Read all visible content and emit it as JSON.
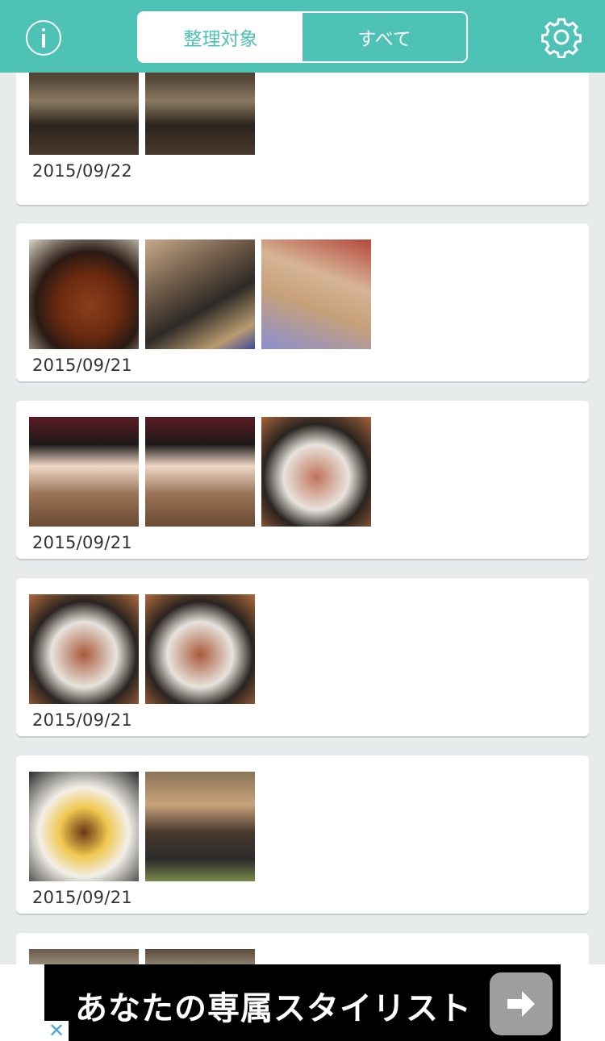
{
  "header": {
    "info_icon": "info-icon",
    "tabs": [
      {
        "label": "整理対象",
        "active": true
      },
      {
        "label": "すべて",
        "active": false
      }
    ],
    "settings_icon": "gear-icon",
    "color": "#4ec2b4"
  },
  "groups": [
    {
      "date": "2015/09/22",
      "photos": [
        "room-window",
        "room-window"
      ]
    },
    {
      "date": "2015/09/21",
      "photos": [
        "tonkatsu-curry",
        "group-selfie-table",
        "group-selfie"
      ]
    },
    {
      "date": "2015/09/21",
      "photos": [
        "girl-ice-cream",
        "girl-ice-cream",
        "fried-food-plate"
      ]
    },
    {
      "date": "2015/09/21",
      "photos": [
        "fried-food-plate",
        "fried-food-plate"
      ]
    },
    {
      "date": "2015/09/21",
      "photos": [
        "omurice-curry",
        "person-photo-table"
      ]
    },
    {
      "date": "",
      "photos": [
        "plate",
        "plate"
      ]
    }
  ],
  "ad": {
    "text": "あなたの専属スタイリスト",
    "close_label": "✕",
    "arrow_icon": "arrow-right-icon"
  }
}
